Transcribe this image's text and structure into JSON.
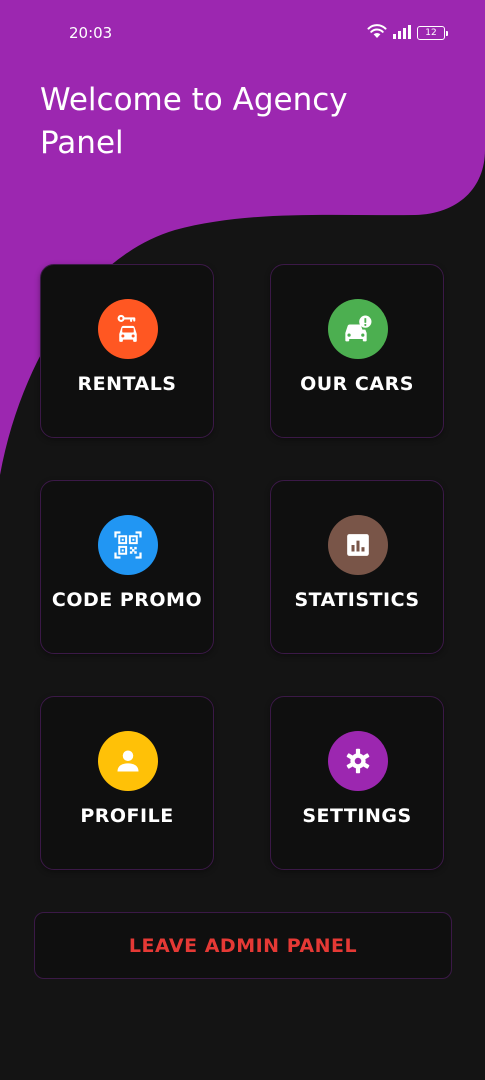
{
  "status_bar": {
    "time": "20:03",
    "battery_level": "12",
    "wifi_icon": "wifi-icon",
    "signal_icon": "signal-bars-icon",
    "battery_icon": "battery-icon"
  },
  "header": {
    "title": "Welcome to Agency Panel",
    "background_color": "#9c27b0"
  },
  "menu": {
    "items": [
      {
        "label": "RENTALS",
        "icon": "car-key-icon",
        "icon_color": "#ff5722"
      },
      {
        "label": "OUR CARS",
        "icon": "car-alert-icon",
        "icon_color": "#4caf50"
      },
      {
        "label": "CODE PROMO",
        "icon": "qr-code-icon",
        "icon_color": "#2196f3"
      },
      {
        "label": "STATISTICS",
        "icon": "bar-chart-icon",
        "icon_color": "#795548"
      },
      {
        "label": "PROFILE",
        "icon": "person-icon",
        "icon_color": "#ffc107"
      },
      {
        "label": "SETTINGS",
        "icon": "gear-icon",
        "icon_color": "#9c27b0"
      }
    ]
  },
  "leave_button": {
    "label": "LEAVE ADMIN PANEL",
    "color": "#e53935"
  },
  "theme": {
    "background": "#141414",
    "card_background": "#0f0f0f",
    "card_border": "#3b1947"
  }
}
